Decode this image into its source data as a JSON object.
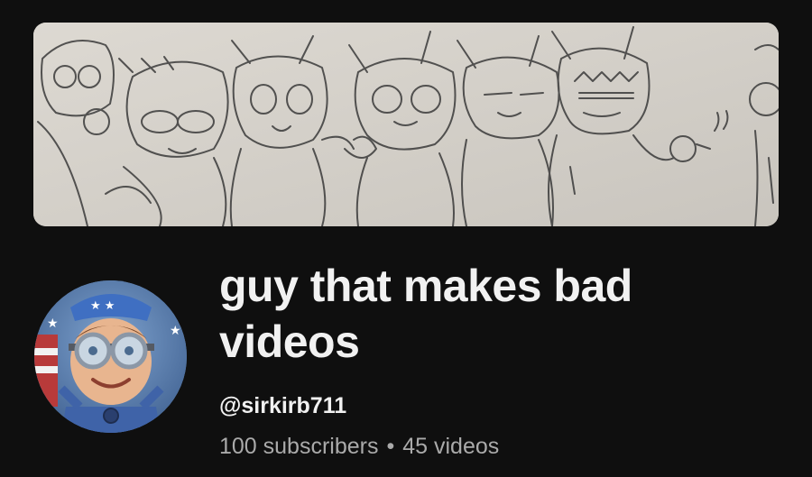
{
  "channel": {
    "name": "guy that makes bad videos",
    "handle": "@sirkirb711",
    "subscribers": "100 subscribers",
    "separator": "•",
    "videos": "45 videos"
  },
  "banner": {
    "description_icon": "pencil-sketch-banner"
  },
  "avatar": {
    "icon": "avatar-icon"
  },
  "colors": {
    "background": "#0f0f0f",
    "text_primary": "#f1f1f1",
    "text_secondary": "#aaaaaa",
    "banner_paper": "#d6d2cb"
  }
}
